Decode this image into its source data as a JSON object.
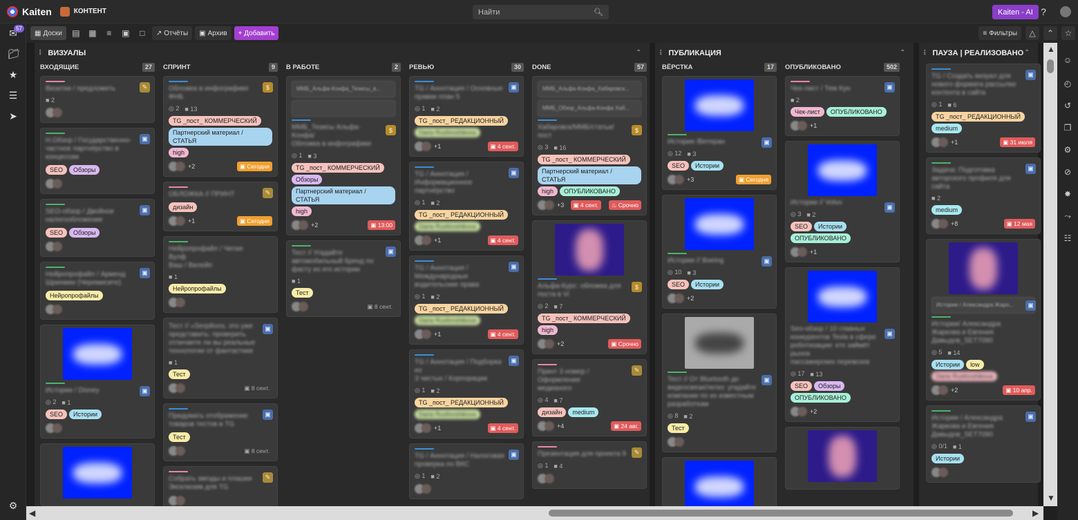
{
  "app": {
    "name": "Kaiten",
    "space": "КОНТЕНТ"
  },
  "search": {
    "placeholder": "Найти"
  },
  "topbar": {
    "ai_label": "Kaiten - AI"
  },
  "nav": {
    "inbox_badge": "57"
  },
  "toolbar": {
    "boards": "Доски",
    "reports": "Отчёты",
    "archive": "Архив",
    "add": "+ Добавить",
    "filters": "Фильтры"
  },
  "groups": [
    {
      "title": "ВИЗУАЛЫ"
    },
    {
      "title": "ПУБЛИКАЦИЯ"
    },
    {
      "title": "ПАУЗА | РЕАЛИЗОВАНО"
    }
  ],
  "columns": [
    {
      "title": "ВХОДЯЩИЕ",
      "count": "27",
      "cards": [
        {
          "accent": "#e889a8",
          "icon": "pencil",
          "lines": [
            "Визитки / предложить"
          ],
          "meta": [
            "2"
          ],
          "tags": [],
          "more": "",
          "due": null
        },
        {
          "accent": "#4ab46a",
          "icon": "blue",
          "lines": [
            "Н.Обзор / Государственно-",
            "частное партнёрство в",
            "концессии"
          ],
          "meta": [],
          "tags": [
            {
              "t": "SEO",
              "c": "#f6c2bc"
            },
            {
              "t": "Обзоры",
              "c": "#d9b8f0"
            }
          ],
          "more": "",
          "due": null
        },
        {
          "accent": "#4ab46a",
          "icon": "blue",
          "lines": [
            "SEO-обзор / Двойное",
            "налогообложение"
          ],
          "meta": [],
          "tags": [
            {
              "t": "SEO",
              "c": "#f6c2bc"
            },
            {
              "t": "Обзоры",
              "c": "#d9b8f0"
            }
          ],
          "more": "",
          "due": null
        },
        {
          "accent": "#4ab46a",
          "icon": "blue",
          "lines": [
            "Нейропрофайл / Арменд",
            "Шрихмин (Черемисите)"
          ],
          "meta": [],
          "tags": [
            {
              "t": "Нейропрофайлы",
              "c": "#f8eca8"
            }
          ],
          "more": "",
          "due": null
        },
        {
          "accent": "#4ab46a",
          "icon": "blue",
          "thumb": "blue",
          "lines": [
            "Истории / Disney"
          ],
          "meta": [
            "2",
            "1"
          ],
          "tags": [
            {
              "t": "SEO",
              "c": "#f6c2bc"
            },
            {
              "t": "Истории",
              "c": "#a8e0f0"
            }
          ],
          "more": "",
          "due": null
        },
        {
          "accent": "",
          "icon": "",
          "thumb": "blue",
          "lines": [],
          "meta": [],
          "tags": [],
          "more": "",
          "due": null
        }
      ]
    },
    {
      "title": "СПРИНТ",
      "count": "9",
      "cards": [
        {
          "accent": "#3a8fd8",
          "icon": "money",
          "lines": [
            "Обложка в инфографике ФНБ"
          ],
          "meta": [
            "2",
            "13"
          ],
          "tags": [
            {
              "t": "TG _пост_ КОММЕРЧЕСКИЙ",
              "c": "#f6c2bc"
            },
            {
              "t": "Партнерский материал / СТАТЬЯ",
              "c": "#a8d4f0"
            },
            {
              "t": "high",
              "c": "#f0b8d0"
            }
          ],
          "more": "+2",
          "due": {
            "t": "Сегодня",
            "k": "orange"
          }
        },
        {
          "accent": "#e889a8",
          "icon": "pencil",
          "lines": [
            "ОБЛОЖКА // ПРИНТ"
          ],
          "meta": [],
          "tags": [
            {
              "t": "дизайн",
              "c": "#f6c2bc"
            }
          ],
          "more": "+1",
          "due": {
            "t": "Сегодня",
            "k": "orange"
          }
        },
        {
          "accent": "#4ab46a",
          "icon": "",
          "lines": [
            "Нейропрофайл / Читая Вулф",
            "Ваш / Вилейп"
          ],
          "meta": [
            "1"
          ],
          "tags": [
            {
              "t": "Нейропрофайлы",
              "c": "#f8eca8"
            }
          ],
          "more": "",
          "due": null
        },
        {
          "accent": "",
          "icon": "blue",
          "lines": [
            "Тест // «Serpilions, это уже",
            "представить: проверить",
            "отличаете ли вы реальные",
            "технологии от фантастики"
          ],
          "meta": [
            "1"
          ],
          "tags": [
            {
              "t": "Тест",
              "c": "#f8eca8"
            }
          ],
          "more": "",
          "due": {
            "t": "8 сент.",
            "k": "plain"
          }
        },
        {
          "accent": "#3a8fd8",
          "icon": "blue",
          "lines": [
            "Придумать отображение",
            "товаров тестов в TG"
          ],
          "meta": [],
          "tags": [
            {
              "t": "Тест",
              "c": "#f8eca8"
            }
          ],
          "more": "",
          "due": {
            "t": "8 сент.",
            "k": "plain"
          }
        },
        {
          "accent": "#e889a8",
          "icon": "pencil",
          "lines": [
            "Собрать звезды и плашки",
            "Эксклюзив для TG"
          ],
          "meta": [],
          "tags": [],
          "more": "",
          "due": null
        }
      ]
    },
    {
      "title": "В РАБОТЕ",
      "count": "2",
      "cards": [
        {
          "accent": "#3a8fd8",
          "icon": "money",
          "subs": [
            "ММБ_Альфа-Конфа_Тезисы_в...",
            ""
          ],
          "lines": [
            "ММБ_Тезисы Альфа-Конфа/",
            "Обложка в инфографике"
          ],
          "meta": [
            "1",
            "3"
          ],
          "tags": [
            {
              "t": "TG _пост_ КОММЕРЧЕСКИЙ",
              "c": "#f6c2bc"
            },
            {
              "t": "Обзоры",
              "c": "#d9b8f0"
            },
            {
              "t": "Партнерский материал / СТАТЬЯ",
              "c": "#a8d4f0"
            },
            {
              "t": "high",
              "c": "#f0b8d0"
            }
          ],
          "more": "+2",
          "due": {
            "t": "13:00",
            "k": "red"
          }
        },
        {
          "accent": "#4ab46a",
          "icon": "blue",
          "lines": [
            "Тест // Угадайте",
            "автомобильный бренд по",
            "фасту из его истории"
          ],
          "meta": [
            "1"
          ],
          "tags": [
            {
              "t": "Тест",
              "c": "#f8eca8"
            }
          ],
          "more": "",
          "due": {
            "t": "8 сент.",
            "k": "plain"
          }
        }
      ]
    },
    {
      "title": "РЕВЬЮ",
      "count": "30",
      "cards": [
        {
          "accent": "#3a8fd8",
          "icon": "blue",
          "lines": [
            "TG / Аннотация / Основные",
            "правки план 5"
          ],
          "meta": [
            "1",
            "2"
          ],
          "tags": [
            {
              "t": "TG _пост_ РЕДАКЦИОННЫЙ",
              "c": "#f8d4a0"
            },
            {
              "t": "Daria Rusfonshikova",
              "c": "#c8e0a0",
              "b": true
            }
          ],
          "more": "+1",
          "due": {
            "t": "4 сент.",
            "k": "red"
          }
        },
        {
          "accent": "#3a8fd8",
          "icon": "blue",
          "lines": [
            "TG / Аннотация /",
            "Информационное",
            "партнёрство"
          ],
          "meta": [
            "1",
            "2"
          ],
          "tags": [
            {
              "t": "TG _пост_ РЕДАКЦИОННЫЙ",
              "c": "#f8d4a0"
            },
            {
              "t": "Daria Rusfonshikova",
              "c": "#c8e0a0",
              "b": true
            }
          ],
          "more": "+1",
          "due": {
            "t": "4 сент.",
            "k": "red"
          }
        },
        {
          "accent": "#3a8fd8",
          "icon": "blue",
          "lines": [
            "TG / Аннотация /",
            "Международные",
            "водительские права"
          ],
          "meta": [
            "1",
            "2"
          ],
          "tags": [
            {
              "t": "TG _пост_ РЕДАКЦИОННЫЙ",
              "c": "#f8d4a0"
            },
            {
              "t": "Daria Rusfonshikova",
              "c": "#c8e0a0",
              "b": true
            }
          ],
          "more": "+1",
          "due": {
            "t": "4 сент.",
            "k": "red"
          }
        },
        {
          "accent": "#3a8fd8",
          "icon": "blue",
          "lines": [
            "TG / Аннотация / Подборка из",
            "3 чистых / Корпорации"
          ],
          "meta": [
            "1",
            "2"
          ],
          "tags": [
            {
              "t": "TG _пост_ РЕДАКЦИОННЫЙ",
              "c": "#f8d4a0"
            },
            {
              "t": "Daria Rusfonshikova",
              "c": "#c8e0a0",
              "b": true
            }
          ],
          "more": "+1",
          "due": {
            "t": "4 сент.",
            "k": "red"
          }
        },
        {
          "accent": "#3a8fd8",
          "icon": "blue",
          "lines": [
            "TG / Аннотация / Налоговая",
            "проверка по ВКС"
          ],
          "meta": [
            "1",
            "2"
          ],
          "tags": [],
          "more": "",
          "due": null
        }
      ]
    },
    {
      "title": "DONE",
      "count": "57",
      "cards": [
        {
          "accent": "#3a8fd8",
          "icon": "money",
          "subs": [
            "ММБ_Альфа-Конфа_Хабаровск...",
            "ММБ_Обзор_Альфа-Конфа Хаб..."
          ],
          "lines": [
            "Хабаровск/ММБ/статьи/пост"
          ],
          "meta": [
            "3",
            "16"
          ],
          "tags": [
            {
              "t": "TG _пост_ КОММЕРЧЕСКИЙ",
              "c": "#f6c2bc"
            },
            {
              "t": "Партнерский материал / СТАТЬЯ",
              "c": "#a8d4f0"
            },
            {
              "t": "high",
              "c": "#f0b8d0"
            },
            {
              "t": "ОПУБЛИКОВАНО",
              "c": "#a8f0d8"
            }
          ],
          "more": "+3",
          "due": {
            "t": "4 сент.",
            "k": "red"
          },
          "due2": "Срочно"
        },
        {
          "accent": "#3a8fd8",
          "icon": "money",
          "thumb": "person",
          "lines": [
            "Альфа-Курс: обложка для",
            "поста в Vi"
          ],
          "meta": [
            "2",
            "7"
          ],
          "tags": [
            {
              "t": "TG _пост_ КОММЕРЧЕСКИЙ",
              "c": "#f6c2bc"
            },
            {
              "t": "high",
              "c": "#f0b8d0"
            }
          ],
          "more": "+2",
          "due": {
            "t": "Срочно",
            "k": "red"
          }
        },
        {
          "accent": "#e889a8",
          "icon": "pencil",
          "lines": [
            "Принт 3 номер / Оформление",
            "медианого"
          ],
          "meta": [
            "4",
            "7"
          ],
          "tags": [
            {
              "t": "дизайн",
              "c": "#f6c2bc"
            },
            {
              "t": "medium",
              "c": "#a8e8f0"
            }
          ],
          "more": "+4",
          "due": {
            "t": "24 авг.",
            "k": "red"
          }
        },
        {
          "accent": "#e889a8",
          "icon": "pencil",
          "lines": [
            "Презентация для проекта 9"
          ],
          "meta": [
            "1",
            "4"
          ],
          "tags": [],
          "more": "",
          "due": null
        }
      ]
    },
    {
      "title": "ВЁРСТКА",
      "count": "17",
      "cards": [
        {
          "accent": "#4ab46a",
          "icon": "blue",
          "thumb": "blue",
          "lines": [
            "Истории /Ветеран"
          ],
          "meta": [
            "12",
            "3"
          ],
          "tags": [
            {
              "t": "SEO",
              "c": "#f6c2bc"
            },
            {
              "t": "Истории",
              "c": "#a8e0f0"
            }
          ],
          "more": "+3",
          "due": {
            "t": "Сегодня",
            "k": "orange"
          }
        },
        {
          "accent": "#4ab46a",
          "icon": "blue",
          "thumb": "blue",
          "lines": [
            "Истории // Boeing"
          ],
          "meta": [
            "10",
            "3"
          ],
          "tags": [
            {
              "t": "SEO",
              "c": "#f6c2bc"
            },
            {
              "t": "Истории",
              "c": "#a8e0f0"
            }
          ],
          "more": "+2",
          "due": null
        },
        {
          "accent": "#4ab46a",
          "icon": "blue",
          "thumb": "photo",
          "lines": [
            "Тест // От Bluetooth до",
            "видеосвязи/легко: угадайте",
            "компании по их известным",
            "разработкам"
          ],
          "meta": [
            "8",
            "2"
          ],
          "tags": [
            {
              "t": "Тест",
              "c": "#f8eca8"
            }
          ],
          "more": "",
          "due": null
        },
        {
          "accent": "",
          "icon": "",
          "thumb": "blue",
          "lines": [],
          "meta": [],
          "tags": [],
          "more": "",
          "due": null
        }
      ]
    },
    {
      "title": "ОПУБЛИКОВАНО",
      "count": "502",
      "cards": [
        {
          "accent": "#e889a8",
          "icon": "blue",
          "lines": [
            "Чек-лист / Тем Кун"
          ],
          "meta": [
            "2"
          ],
          "tags": [
            {
              "t": "Чек-лист",
              "c": "#f0b8d0"
            },
            {
              "t": "ОПУБЛИКОВАНО",
              "c": "#a8f0d8"
            }
          ],
          "more": "+1",
          "due": null
        },
        {
          "accent": "",
          "icon": "blue",
          "thumb": "blue",
          "lines": [
            "Истории // Volvo"
          ],
          "meta": [
            "3",
            "2"
          ],
          "tags": [
            {
              "t": "SEO",
              "c": "#f6c2bc"
            },
            {
              "t": "Истории",
              "c": "#a8e0f0"
            },
            {
              "t": "ОПУБЛИКОВАНО",
              "c": "#a8f0d8"
            }
          ],
          "more": "+1",
          "due": null
        },
        {
          "accent": "",
          "icon": "blue",
          "thumb": "blue",
          "lines": [
            "Seo-обзор / 10 главных",
            "конкурентов Tesla в сфере",
            "роботизации: кто займёт рынок",
            "пассажирских перевозок"
          ],
          "meta": [
            "17",
            "13"
          ],
          "tags": [
            {
              "t": "SEO",
              "c": "#f6c2bc"
            },
            {
              "t": "Обзоры",
              "c": "#d9b8f0"
            },
            {
              "t": "ОПУБЛИКОВАНО",
              "c": "#a8f0d8"
            }
          ],
          "more": "+2",
          "due": null
        },
        {
          "accent": "",
          "icon": "",
          "thumb": "person",
          "lines": [],
          "meta": [],
          "tags": [],
          "more": "",
          "due": null
        }
      ]
    },
    {
      "title": "",
      "count": "",
      "cards": [
        {
          "accent": "#3a8fd8",
          "icon": "blue",
          "lines": [
            "TG / Создать визуал для",
            "нового формата рассылки",
            "контента в сайта"
          ],
          "meta": [
            "1",
            "6"
          ],
          "tags": [
            {
              "t": "TG _пост_ РЕДАКЦИОННЫЙ",
              "c": "#f8d4a0"
            },
            {
              "t": "medium",
              "c": "#a8e8f0"
            }
          ],
          "more": "+1",
          "due": {
            "t": "31 июля",
            "k": "red"
          }
        },
        {
          "accent": "#4ab46a",
          "icon": "blue",
          "lines": [
            "Задача: Подготовка",
            "авторского профиля для",
            "сайта"
          ],
          "meta": [
            "2"
          ],
          "tags": [
            {
              "t": "medium",
              "c": "#a8e8f0"
            }
          ],
          "more": "+8",
          "due": {
            "t": "12 мая",
            "k": "red"
          }
        },
        {
          "accent": "#4ab46a",
          "icon": "blue",
          "thumb": "person",
          "subs": [
            "Истории / Александра Жаро..."
          ],
          "lines": [
            "Истории/ Александра",
            "Жаркова и Евгения",
            "Давыдов_SET7090"
          ],
          "meta": [
            "5",
            "14"
          ],
          "tags": [
            {
              "t": "Истории",
              "c": "#a8e0f0"
            },
            {
              "t": "low",
              "c": "#f8eca8"
            },
            {
              "t": "Daria Rusfonshikova",
              "c": "#f0b8c0",
              "b": true
            }
          ],
          "more": "+2",
          "due": {
            "t": "10 апр.",
            "k": "red"
          }
        },
        {
          "accent": "#4ab46a",
          "icon": "blue",
          "lines": [
            "Истории / Александра",
            "Жаркова и Евгения",
            "Давыдов_SET7090"
          ],
          "meta": [
            "0/1",
            "1"
          ],
          "tags": [
            {
              "t": "Истории",
              "c": "#a8e0f0"
            }
          ],
          "more": "",
          "due": null
        }
      ]
    }
  ],
  "pause_column_title": "ПАУЗА | РЕАЛИЗОВАНО"
}
